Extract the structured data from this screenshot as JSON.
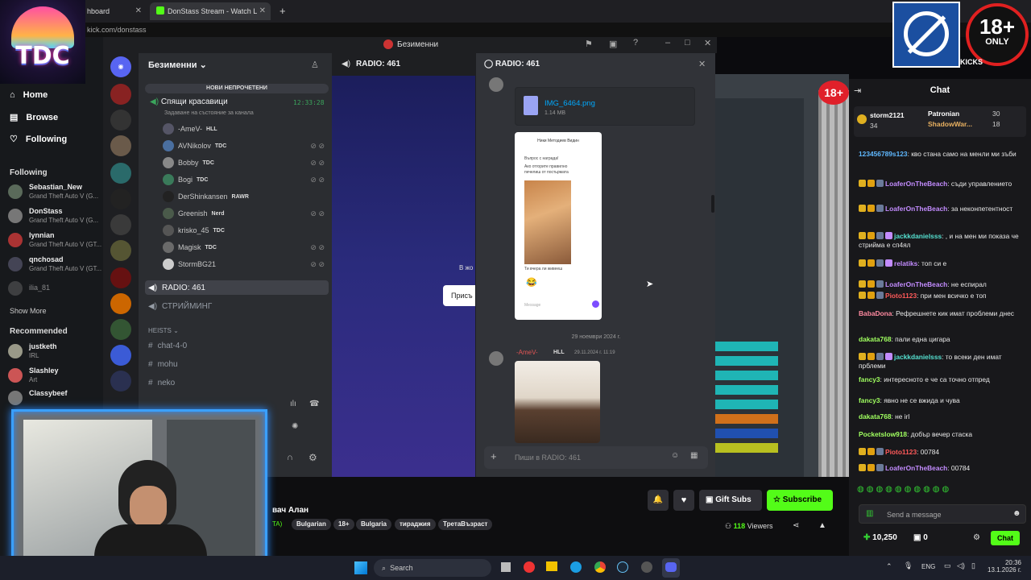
{
  "browser": {
    "tab1": "hboard",
    "tab2": "DonStass Stream - Watch L",
    "url": "kick.com/donstass"
  },
  "overlay": {
    "logo": "TDC",
    "age_badge": "18+",
    "age_only": "ONLY",
    "kicks": "KICKS",
    "age_small": "18+"
  },
  "kick_sidebar": {
    "nav": [
      {
        "label": "Home",
        "icon": "home-icon"
      },
      {
        "label": "Browse",
        "icon": "browse-icon"
      },
      {
        "label": "Following",
        "icon": "heart-icon"
      }
    ],
    "following_title": "Following",
    "following": [
      {
        "name": "Sebastian_New",
        "game": "Grand Theft Auto V (G..."
      },
      {
        "name": "DonStass",
        "game": "Grand Theft Auto V (G..."
      },
      {
        "name": "lynnian",
        "game": "Grand Theft Auto V (GT..."
      },
      {
        "name": "qnchosad",
        "game": "Grand Theft Auto V (GT..."
      },
      {
        "name": "ilia_81",
        "game": ""
      }
    ],
    "show_more": "Show More",
    "recommended_title": "Recommended",
    "recommended": [
      {
        "name": "justketh",
        "game": "IRL"
      },
      {
        "name": "Slashley",
        "game": "Art"
      },
      {
        "name": "Classybeef",
        "game": ""
      }
    ]
  },
  "discord": {
    "window_title": "Безименни",
    "server_name": "Безименни",
    "unread_banner": "НОВИ НЕПРОЧЕТЕНИ",
    "voice_channel": {
      "name": "Спящи красавици",
      "time": "12:33:28",
      "status": "Задаване на състояние за канала"
    },
    "voice_users": [
      {
        "name": "-AmeV-",
        "tag": "HLL",
        "color": "#e8a040"
      },
      {
        "name": "AVNikolov",
        "tag": "TDC",
        "color": "#e24"
      },
      {
        "name": "Bobby",
        "tag": "TDC",
        "color": "#e24"
      },
      {
        "name": "Bogi",
        "tag": "TDC",
        "color": "#e24"
      },
      {
        "name": "DerShinkansen",
        "tag": "RAWR",
        "color": "#a070e0"
      },
      {
        "name": "Greenish",
        "tag": "Nerd",
        "color": "#3c3"
      },
      {
        "name": "krisko_45",
        "tag": "TDC",
        "color": "#e24"
      },
      {
        "name": "Magisk",
        "tag": "TDC",
        "color": "#e24"
      },
      {
        "name": "StormBG21",
        "tag": "",
        "color": "#e24"
      }
    ],
    "channels": [
      {
        "name": "RADIO: 461",
        "type": "voice"
      },
      {
        "name": "СТРИЙМИНГ",
        "type": "voice"
      }
    ],
    "category": "HEISTS",
    "text_channels": [
      "chat-4-0",
      "mohu",
      "neko"
    ],
    "main_header": "RADIO: 461",
    "main_partial_text": "В жо",
    "main_partial_button": "Присъ",
    "thread": {
      "title": "RADIO: 461",
      "file_name": "IMG_6464.png",
      "file_size": "1.14 MB",
      "date_divider": "29 ноември 2024 г.",
      "msg_author": "-AmeV-",
      "msg_tag": "HLL",
      "msg_time": "29.11.2024 г. 11:19",
      "composer_placeholder": "Пиши в RADIO: 461",
      "phone_header": "Ники Методиев Видин",
      "phone_lines": [
        "Въпрос с награда!",
        "Ако отгорите правилно",
        "печелиш от постьрмата",
        "Ти вчера ли живееш"
      ],
      "phone_input": "Message"
    }
  },
  "stream": {
    "title_partial": "вач Алан",
    "title_prefix": "TA)",
    "tags": [
      "Bulgarian",
      "18+",
      "Bulgaria",
      "тираджия",
      "ТретаВъзраст"
    ],
    "viewers": "118",
    "viewers_label": "Viewers",
    "gift_subs": "Gift Subs",
    "subscribe": "Subscribe"
  },
  "chat": {
    "title": "Chat",
    "pinned": [
      {
        "name": "storm2121",
        "count": "34"
      },
      {
        "name": "Patronian",
        "count": "30"
      },
      {
        "name": "ShadowWar...",
        "count": "18"
      }
    ],
    "messages": [
      {
        "user": "123456789s123",
        "color": "#5fb8ff",
        "text": "кво стана само на менли ми зъби",
        "badges": 0
      },
      {
        "user": "LoaferOnTheBeach",
        "color": "#c38cff",
        "text": "съди управлението",
        "badges": 3
      },
      {
        "user": "LoaferOnTheBeach",
        "color": "#c38cff",
        "text": "за неконпетентност",
        "badges": 3
      },
      {
        "user": "jackkdanielsss",
        "color": "#55e0d0",
        "text": ", и на мен ми показа че стриймa е сп4ял",
        "badges": 4
      },
      {
        "user": "relatiks",
        "color": "#c38cff",
        "text": "топ си е",
        "badges": 4
      },
      {
        "user": "LoaferOnTheBeach",
        "color": "#c38cff",
        "text": "не еспирал",
        "badges": 3
      },
      {
        "user": "Pioto1123",
        "color": "#ff5a5a",
        "text": "при мен всичко е топ",
        "badges": 3
      },
      {
        "user": "BabaDona",
        "color": "#ff8aa0",
        "text": "Рефрешнете кик имат проблеми днес",
        "badges": 0
      },
      {
        "user": "dakata768",
        "color": "#a0ff60",
        "text": "пали една цигара",
        "badges": 0
      },
      {
        "user": "jackkdanielsss",
        "color": "#55e0d0",
        "text": "то всеки ден имат прблеми",
        "badges": 4
      },
      {
        "user": "fancy3",
        "color": "#a0ff60",
        "text": "интересното е че са точно отпред",
        "badges": 0
      },
      {
        "user": "fancy3",
        "color": "#a0ff60",
        "text": "явно не се вжида и чува",
        "badges": 0
      },
      {
        "user": "dakata768",
        "color": "#a0ff60",
        "text": "не irl",
        "badges": 0
      },
      {
        "user": "Pocketslow918",
        "color": "#a0ff60",
        "text": "добър вечер стаска",
        "badges": 0
      },
      {
        "user": "Pioto1123",
        "color": "#ff5a5a",
        "text": "00784",
        "badges": 3
      },
      {
        "user": "LoaferOnTheBeach",
        "color": "#c38cff",
        "text": "00784",
        "badges": 3
      }
    ],
    "input_placeholder": "Send a message",
    "points": "10,250",
    "gifts": "0",
    "send": "Chat"
  },
  "taskbar": {
    "search": "Search",
    "lang": "ENG",
    "time": "20:36",
    "date": "13.1.2026 г."
  }
}
